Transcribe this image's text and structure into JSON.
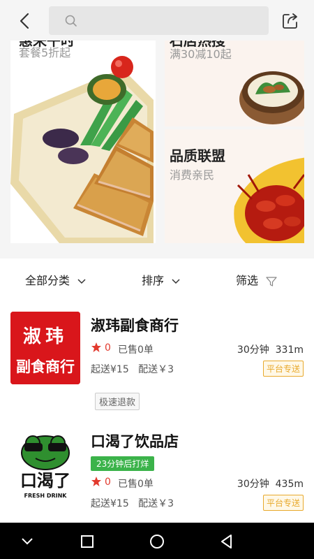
{
  "header": {
    "search": {
      "placeholder": ""
    }
  },
  "banners": {
    "big": {
      "title": "惠来午时",
      "subtitle": "套餐5折起"
    },
    "small_1": {
      "title": "石店热搜",
      "subtitle": "满30减10起"
    },
    "small_2": {
      "title": "品质联盟",
      "subtitle": "消费亲民"
    }
  },
  "filters": {
    "category": "全部分类",
    "sort": "排序",
    "filter": "筛选"
  },
  "shops": [
    {
      "logo_text_line1": "淑玮",
      "logo_text_line2": "副食商行",
      "name": "淑玮副食商行",
      "rating": "0",
      "sold": "已售0单",
      "time": "30分钟",
      "distance": "331m",
      "min_order": "起送¥15",
      "delivery_fee": "配送￥3",
      "delivery_badge": "平台专送",
      "tag": "极速退款"
    },
    {
      "logo_text": "口渴了",
      "logo_caption": "FRESH DRINK",
      "name": "口渴了饮品店",
      "promo_tag": "23分钟后打烊",
      "rating": "0",
      "sold": "已售0单",
      "time": "30分钟",
      "distance": "435m",
      "min_order": "起送¥15",
      "delivery_fee": "配送￥3",
      "delivery_badge": "平台专送"
    }
  ],
  "colors": {
    "accent_red": "#e23a2e",
    "badge_orange": "#e8a92c",
    "tag_green": "#3bb34a",
    "logo_red": "#d9161b"
  }
}
